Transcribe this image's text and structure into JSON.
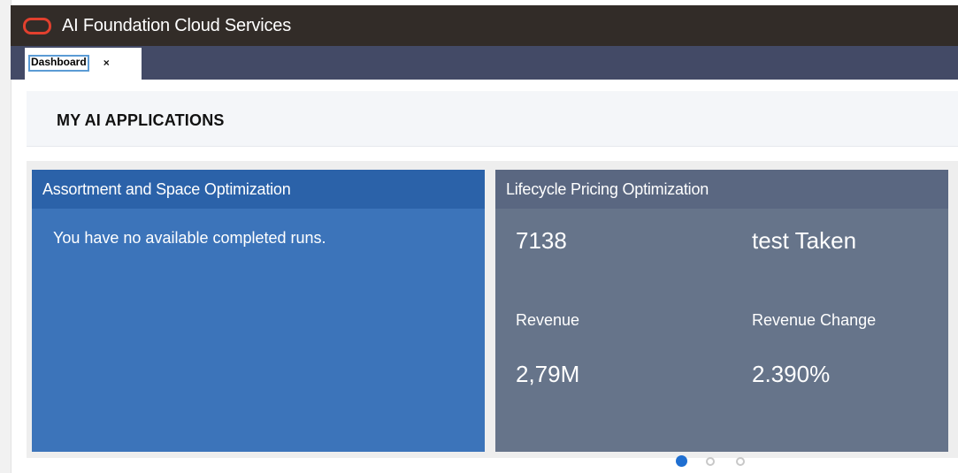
{
  "app": {
    "title": "AI Foundation Cloud Services",
    "brand_color": "#e2402e",
    "titlebar_color": "#322c28"
  },
  "tabs": [
    {
      "label": "Dashboard",
      "close": "×",
      "active": true
    }
  ],
  "section": {
    "title": "MY AI  APPLICATIONS"
  },
  "cards": {
    "aso": {
      "title": "Assortment and Space Optimization",
      "message": "You have no available completed runs.",
      "color": "#3c74ba"
    },
    "lpo": {
      "title": "Lifecycle Pricing Optimization",
      "metric1_value": "7138",
      "metric1_label": "test Taken",
      "revenue_label": "Revenue",
      "revenue_value": "2,79M",
      "revenue_change_label": "Revenue Change",
      "revenue_change_value": "2.390%",
      "color": "#66748a"
    }
  },
  "pager": {
    "total": 3,
    "active_index": 0,
    "active_color": "#1f6fd1"
  }
}
